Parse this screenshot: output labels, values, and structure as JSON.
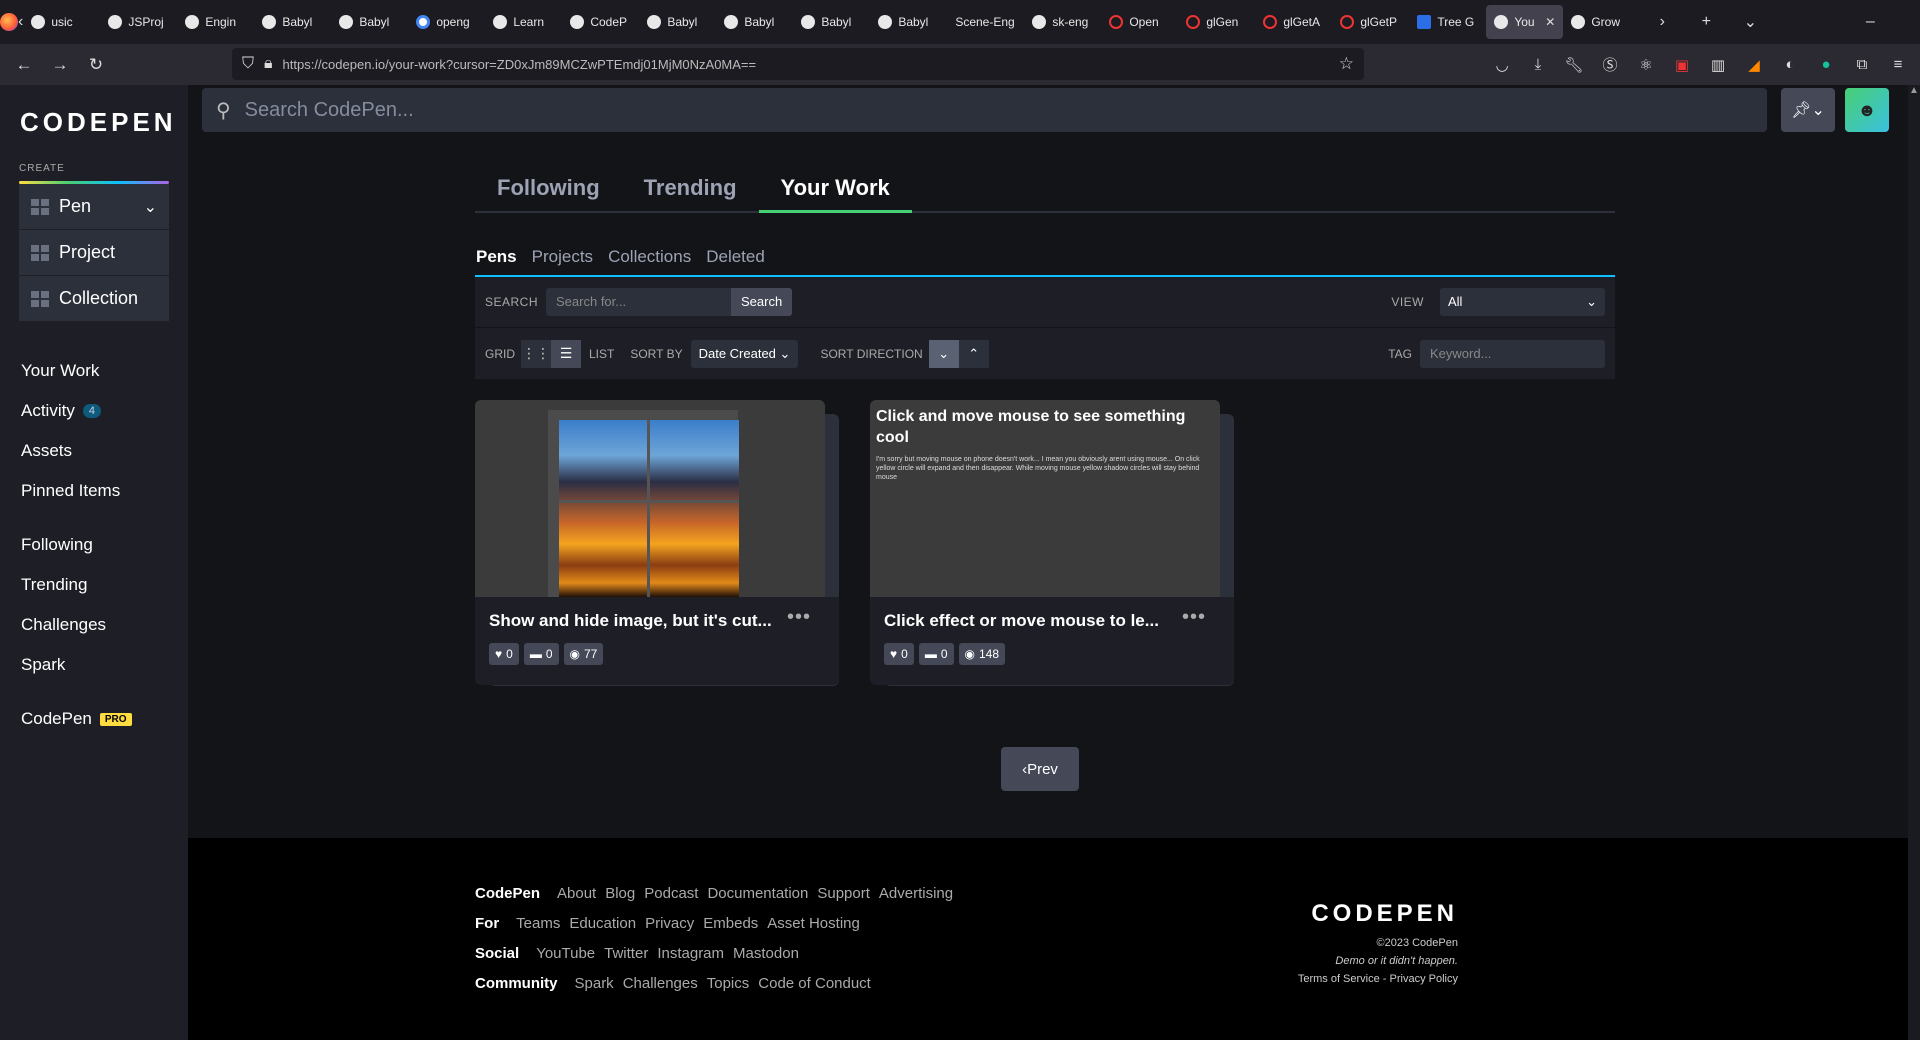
{
  "browser": {
    "tabs": [
      {
        "label": "usic",
        "icon": "generic"
      },
      {
        "label": "JSProj",
        "icon": "github"
      },
      {
        "label": "Engin",
        "icon": "generic"
      },
      {
        "label": "Babyl",
        "icon": "github"
      },
      {
        "label": "Babyl",
        "icon": "github"
      },
      {
        "label": "openg",
        "icon": "google"
      },
      {
        "label": "Learn",
        "icon": "generic"
      },
      {
        "label": "CodeP",
        "icon": "generic"
      },
      {
        "label": "Babyl",
        "icon": "generic"
      },
      {
        "label": "Babyl",
        "icon": "github"
      },
      {
        "label": "Babyl",
        "icon": "github"
      },
      {
        "label": "Babyl",
        "icon": "github"
      },
      {
        "label": "Scene-Eng",
        "icon": "none"
      },
      {
        "label": "sk-eng",
        "icon": "github"
      },
      {
        "label": "Open",
        "icon": "opengl"
      },
      {
        "label": "glGen",
        "icon": "opengl"
      },
      {
        "label": "glGetA",
        "icon": "opengl"
      },
      {
        "label": "glGetP",
        "icon": "opengl"
      },
      {
        "label": "Tree G",
        "icon": "threejs"
      },
      {
        "label": "You",
        "icon": "codepen",
        "active": true
      },
      {
        "label": "Grow",
        "icon": "codepen"
      }
    ],
    "url": "https://codepen.io/your-work?cursor=ZD0xJm89MCZwPTEmdj01MjM0NzA0MA=="
  },
  "sidebar": {
    "logo": "CODEPEN",
    "create_label": "CREATE",
    "create_items": [
      "Pen",
      "Project",
      "Collection"
    ],
    "links_group1": [
      {
        "label": "Your Work"
      },
      {
        "label": "Activity",
        "badge": "4"
      },
      {
        "label": "Assets"
      },
      {
        "label": "Pinned Items"
      }
    ],
    "links_group2": [
      "Following",
      "Trending",
      "Challenges",
      "Spark"
    ],
    "codepen_pro": {
      "label": "CodePen",
      "badge": "PRO"
    }
  },
  "header": {
    "search_placeholder": "Search CodePen..."
  },
  "main": {
    "top_tabs": [
      "Following",
      "Trending",
      "Your Work"
    ],
    "active_top_tab": "Your Work",
    "sub_tabs": [
      "Pens",
      "Projects",
      "Collections",
      "Deleted"
    ],
    "active_sub_tab": "Pens",
    "filter": {
      "search_label": "SEARCH",
      "search_placeholder": "Search for...",
      "search_button": "Search",
      "view_label": "VIEW",
      "view_value": "All",
      "grid_label": "GRID",
      "list_label": "LIST",
      "sort_by_label": "SORT BY",
      "sort_by_value": "Date Created",
      "sort_direction_label": "SORT DIRECTION",
      "tag_label": "TAG",
      "tag_placeholder": "Keyword..."
    },
    "cards": [
      {
        "title": "Show and hide image, but it's cut...",
        "likes": "0",
        "comments": "0",
        "views": "77"
      },
      {
        "title": "Click effect or move mouse to le...",
        "preview_title": "Click and move mouse to see something cool",
        "preview_desc": "I'm sorry but moving mouse on phone doesn't work... I mean you obviously arent using mouse... On click yellow circle will expand and then disappear. While moving mouse yellow shadow circles will stay behind mouse",
        "likes": "0",
        "comments": "0",
        "views": "148"
      }
    ],
    "prev_button": "Prev"
  },
  "footer": {
    "rows": [
      {
        "head": "CodePen",
        "links": [
          "About",
          "Blog",
          "Podcast",
          "Documentation",
          "Support",
          "Advertising"
        ]
      },
      {
        "head": "For",
        "links": [
          "Teams",
          "Education",
          "Privacy",
          "Embeds",
          "Asset Hosting"
        ]
      },
      {
        "head": "Social",
        "links": [
          "YouTube",
          "Twitter",
          "Instagram",
          "Mastodon"
        ]
      },
      {
        "head": "Community",
        "links": [
          "Spark",
          "Challenges",
          "Topics",
          "Code of Conduct"
        ]
      }
    ],
    "logo": "CODEPEN",
    "copyright": "©2023 CodePen",
    "tagline": "Demo or it didn't happen.",
    "terms": "Terms of Service",
    "privacy": "Privacy Policy"
  }
}
